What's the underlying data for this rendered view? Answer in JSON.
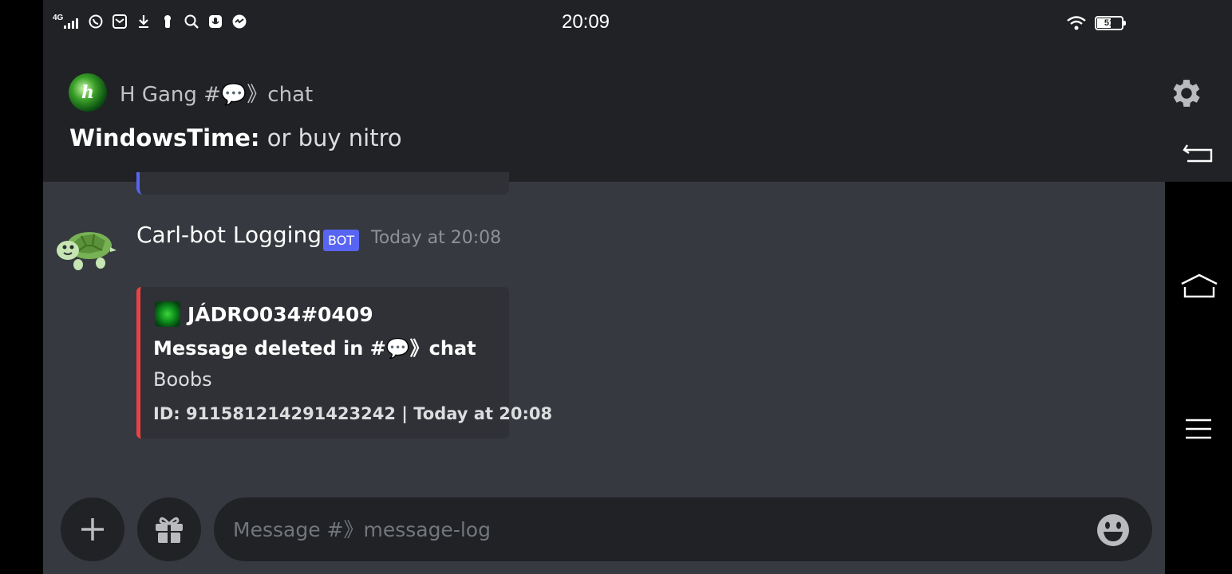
{
  "status_bar": {
    "network": "4G",
    "time": "20:09",
    "battery": "51"
  },
  "notification": {
    "server_initial": "h",
    "title": "H Gang #💬》chat",
    "author": "WindowsTime:",
    "message": " or buy nitro"
  },
  "message": {
    "author": "Carl-bot Logging",
    "bot_tag": "BOT",
    "timestamp": "Today at 20:08",
    "embed": {
      "author": "JÁDRO034#0409",
      "title": "Message deleted in #💬》chat",
      "description": "Boobs",
      "footer": "ID: 911581214291423242 | Today at 20:08",
      "color": "#ed4245"
    }
  },
  "composer": {
    "placeholder": "Message #》message-log"
  },
  "colors": {
    "background": "#36393f",
    "header": "#202225",
    "blurple": "#5865f2"
  }
}
